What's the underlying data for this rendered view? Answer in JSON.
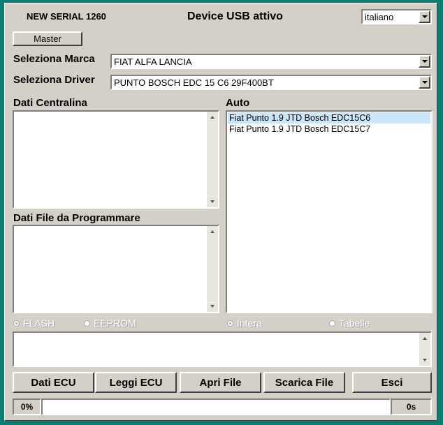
{
  "header": {
    "serial": "NEW SERIAL 1260",
    "device_status": "Device USB attivo",
    "language": "italiano"
  },
  "master_button": "Master",
  "marca": {
    "label": "Seleziona Marca",
    "value": "FIAT ALFA LANCIA"
  },
  "driver": {
    "label": "Seleziona Driver",
    "value": "PUNTO BOSCH EDC 15 C6  29F400BT"
  },
  "dati_centralina": {
    "label": "Dati Centralina"
  },
  "dati_file": {
    "label": "Dati File da Programmare"
  },
  "auto": {
    "label": "Auto",
    "items": [
      "Fiat Punto 1.9 JTD Bosch EDC15C6",
      "Fiat Punto 1.9 JTD Bosch EDC15C7"
    ],
    "selected_index": 0
  },
  "radios": {
    "flash": "FLASH",
    "eeprom": "EEPROM",
    "intera": "Intera",
    "tabelle": "Tabelle"
  },
  "buttons": {
    "dati_ecu": "Dati ECU",
    "leggi_ecu": "Leggi ECU",
    "apri_file": "Apri File",
    "scarica_file": "Scarica File",
    "esci": "Esci"
  },
  "status": {
    "progress_text": "0%",
    "progress": 0,
    "time": "0s"
  }
}
